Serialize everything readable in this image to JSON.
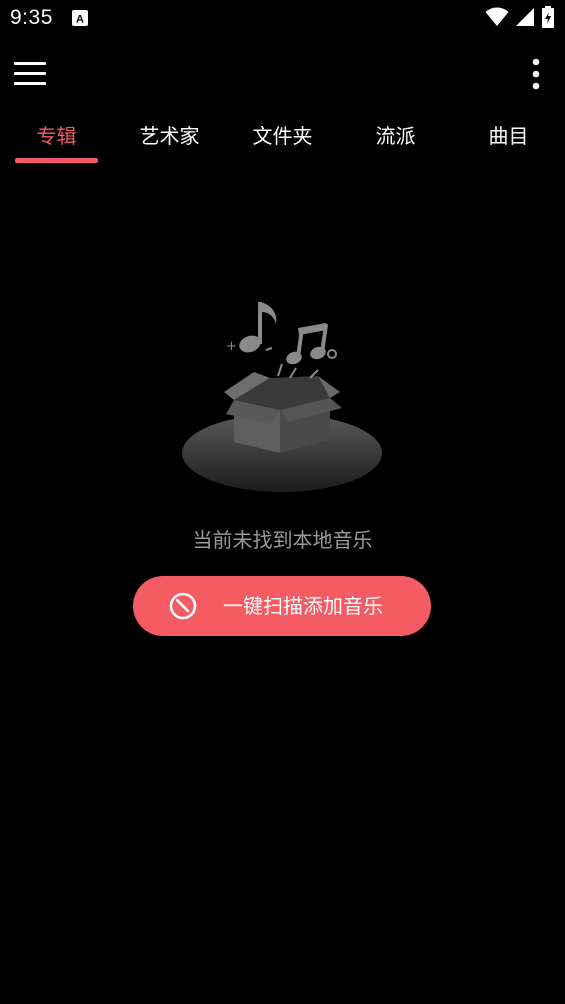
{
  "status_bar": {
    "time": "9:35",
    "icons": [
      "notification-a-icon",
      "wifi-icon",
      "signal-icon",
      "battery-icon"
    ]
  },
  "toolbar": {
    "menu_icon": "hamburger-menu-icon",
    "more_icon": "more-vertical-icon"
  },
  "tabs": [
    {
      "label": "专辑",
      "active": true
    },
    {
      "label": "艺术家",
      "active": false
    },
    {
      "label": "文件夹",
      "active": false
    },
    {
      "label": "流派",
      "active": false
    },
    {
      "label": "曲目",
      "active": false
    }
  ],
  "empty_state": {
    "illustration": "empty-box-music-notes-icon",
    "message": "当前未找到本地音乐",
    "action_label": "一键扫描添加音乐",
    "action_icon": "scan-timer-icon"
  },
  "colors": {
    "background": "#000000",
    "accent": "#f05a68",
    "button": "#f45b63",
    "muted_text": "#9a9a9a"
  }
}
